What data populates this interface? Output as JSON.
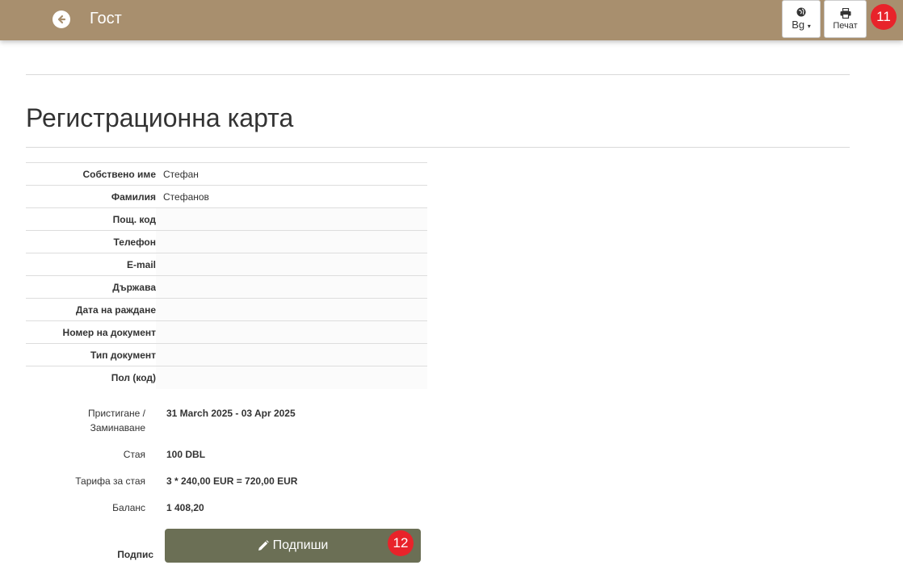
{
  "header": {
    "title": "Гост",
    "language_label": "Bg",
    "print_label": "Печат",
    "badge_print": "11"
  },
  "card": {
    "title": "Регистрационна карта"
  },
  "guest_fields": [
    {
      "label": "Собствено име",
      "value": "Стефан"
    },
    {
      "label": "Фамилия",
      "value": "Стефанов"
    },
    {
      "label": "Пощ. код",
      "value": ""
    },
    {
      "label": "Телефон",
      "value": ""
    },
    {
      "label": "E-mail",
      "value": ""
    },
    {
      "label": "Държава",
      "value": ""
    },
    {
      "label": "Дата на раждане",
      "value": ""
    },
    {
      "label": "Номер на документ",
      "value": ""
    },
    {
      "label": "Тип документ",
      "value": ""
    },
    {
      "label": "Пол (код)",
      "value": ""
    }
  ],
  "stay": {
    "arrival_label_line1": "Пристигане /",
    "arrival_label_line2": "Заминаване",
    "arrival_value": "31 March 2025 - 03 Apr 2025",
    "room_label": "Стая",
    "room_value": "100 DBL",
    "rate_label": "Тарифа за стая",
    "rate_value": "3 * 240,00 EUR = 720,00 EUR",
    "balance_label": "Баланс",
    "balance_value": "1 408,20"
  },
  "signature": {
    "label": "Подпис",
    "button_label": "Подпиши",
    "badge": "12"
  },
  "colors": {
    "topbar": "#a88f6e",
    "sign_button": "#6b6f55",
    "badge": "#e8232a"
  }
}
